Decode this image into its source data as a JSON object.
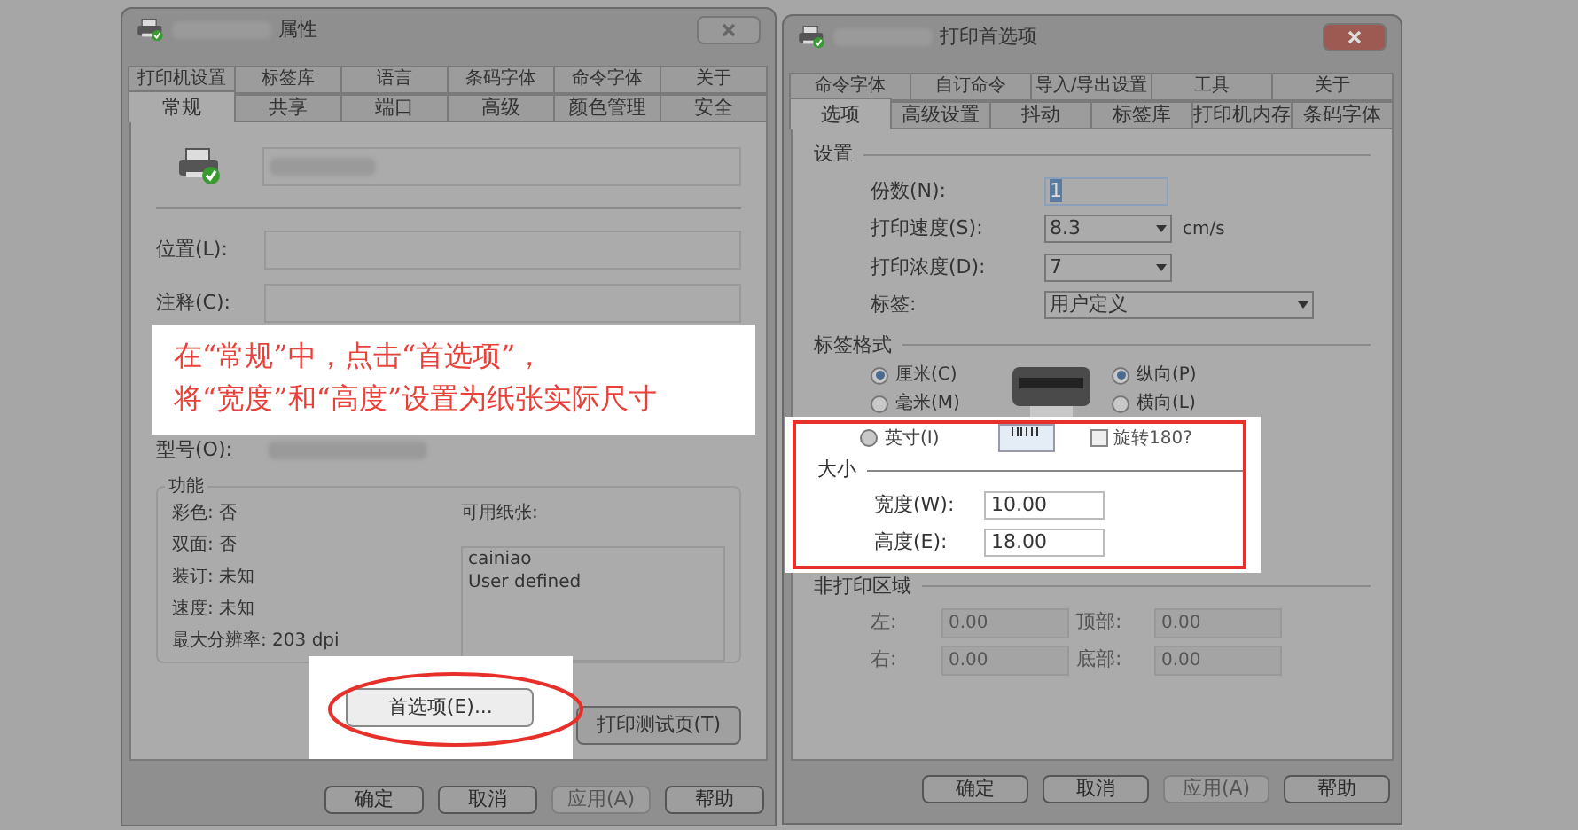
{
  "left_dialog": {
    "title": "属性",
    "tabs_back": [
      {
        "label": "打印机设置",
        "selected": false
      },
      {
        "label": "标签库",
        "selected": false
      },
      {
        "label": "语言",
        "selected": false
      },
      {
        "label": "条码字体",
        "selected": false
      },
      {
        "label": "命令字体",
        "selected": false
      },
      {
        "label": "关于",
        "selected": false
      }
    ],
    "tabs_front": [
      {
        "label": "常规",
        "selected": true
      },
      {
        "label": "共享",
        "selected": false
      },
      {
        "label": "端口",
        "selected": false
      },
      {
        "label": "高级",
        "selected": false
      },
      {
        "label": "颜色管理",
        "selected": false
      },
      {
        "label": "安全",
        "selected": false
      }
    ],
    "fields": [
      {
        "label": "位置(L):"
      },
      {
        "label": "注释(C):"
      }
    ],
    "model_label": "型号(O):",
    "features": {
      "title": "功能",
      "items": [
        "彩色: 否",
        "双面: 否",
        "装订: 未知",
        "速度: 未知",
        "最大分辨率: 203 dpi"
      ],
      "paper_label": "可用纸张:",
      "papers": [
        "cainiao",
        "User defined"
      ]
    },
    "preferences_button": "首选项(E)...",
    "test_page_button": "打印测试页(T)",
    "buttons": [
      {
        "label": "确定",
        "disabled": false
      },
      {
        "label": "取消",
        "disabled": false
      },
      {
        "label": "应用(A)",
        "disabled": true
      },
      {
        "label": "帮助",
        "disabled": false
      }
    ]
  },
  "callout": {
    "lines": [
      "在“常规”中，点击“首选项”，",
      "将“宽度”和“高度”设置为纸张实际尺寸"
    ]
  },
  "right_dialog": {
    "title": "打印首选项",
    "tabs_back": [
      {
        "label": "命令字体",
        "selected": false
      },
      {
        "label": "自订命令",
        "selected": false
      },
      {
        "label": "导入/导出设置",
        "selected": false
      },
      {
        "label": "工具",
        "selected": false
      },
      {
        "label": "关于",
        "selected": false
      }
    ],
    "tabs_front": [
      {
        "label": "选项",
        "selected": true
      },
      {
        "label": "高级设置",
        "selected": false
      },
      {
        "label": "抖动",
        "selected": false
      },
      {
        "label": "标签库",
        "selected": false
      },
      {
        "label": "打印机内存",
        "selected": false
      },
      {
        "label": "条码字体",
        "selected": false
      }
    ],
    "settings": {
      "title": "设置",
      "rows": [
        {
          "kind": "input",
          "label": "份数(N):",
          "value": "1"
        },
        {
          "kind": "select",
          "label": "打印速度(S):",
          "value": "8.3",
          "unit": "cm/s"
        },
        {
          "kind": "select",
          "label": "打印浓度(D):",
          "value": "7"
        },
        {
          "kind": "wide_select",
          "label": "标签:",
          "value": "用户定义"
        }
      ]
    },
    "label_format": {
      "title": "标签格式",
      "units": [
        {
          "label": "厘米(C)",
          "selected": true
        },
        {
          "label": "毫米(M)",
          "selected": false
        },
        {
          "label": "英寸(I)",
          "selected": false
        }
      ],
      "orientation": [
        {
          "label": "纵向(P)",
          "selected": true
        },
        {
          "label": "横向(L)",
          "selected": false
        }
      ],
      "rotate": {
        "label": "旋转180?",
        "checked": false
      }
    },
    "size": {
      "title": "大小",
      "fields": [
        {
          "label": "宽度(W):",
          "value": "10.00"
        },
        {
          "label": "高度(E):",
          "value": "18.00"
        }
      ]
    },
    "non_print": {
      "title": "非打印区域",
      "disabled": true,
      "fields": [
        {
          "label": "左:",
          "value": "0.00"
        },
        {
          "label": "顶部:",
          "value": "0.00"
        },
        {
          "label": "右:",
          "value": "0.00"
        },
        {
          "label": "底部:",
          "value": "0.00"
        }
      ]
    },
    "buttons": [
      {
        "label": "确定",
        "disabled": false
      },
      {
        "label": "取消",
        "disabled": false
      },
      {
        "label": "应用(A)",
        "disabled": true
      },
      {
        "label": "帮助",
        "disabled": false
      }
    ]
  }
}
